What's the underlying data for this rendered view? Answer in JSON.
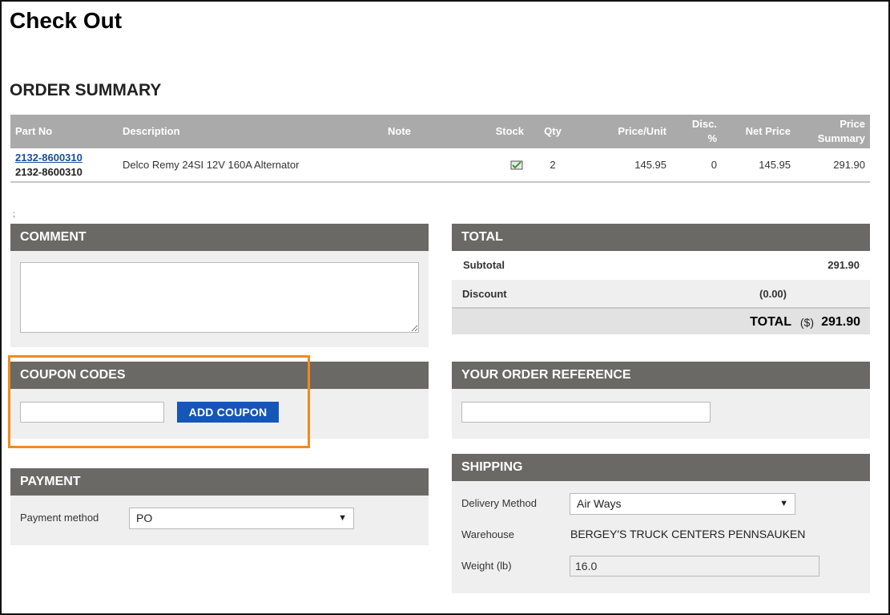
{
  "page": {
    "title": "Check Out",
    "section": "ORDER SUMMARY",
    "stray_mark": ";"
  },
  "table": {
    "headers": {
      "part_no": "Part No",
      "description": "Description",
      "note": "Note",
      "stock": "Stock",
      "qty": "Qty",
      "price_unit": "Price/Unit",
      "disc_line1": "Disc.",
      "disc_line2": "%",
      "net_price": "Net Price",
      "price_summary_line1": "Price",
      "price_summary_line2": "Summary"
    },
    "rows": [
      {
        "part_link": "2132-8600310",
        "part_sub": "2132-8600310",
        "description": "Delco Remy 24SI 12V 160A Alternator",
        "note": "",
        "stock_icon": "in-stock-check-icon",
        "qty": "2",
        "price_unit": "145.95",
        "disc": "0",
        "net_price": "145.95",
        "price_summary": "291.90"
      }
    ]
  },
  "comment": {
    "title": "COMMENT",
    "value": ""
  },
  "coupon": {
    "title": "COUPON CODES",
    "value": "",
    "button": "ADD COUPON",
    "highlight_color": "#f08a1c"
  },
  "payment": {
    "title": "PAYMENT",
    "method_label": "Payment method",
    "method_value": "PO"
  },
  "total": {
    "title": "TOTAL",
    "subtotal_label": "Subtotal",
    "subtotal_value": "291.90",
    "discount_label": "Discount",
    "discount_value": "(0.00)",
    "total_label": "TOTAL",
    "currency": "($)",
    "total_value": "291.90"
  },
  "order_reference": {
    "title": "YOUR ORDER REFERENCE",
    "value": ""
  },
  "shipping": {
    "title": "SHIPPING",
    "delivery_label": "Delivery Method",
    "delivery_value": "Air Ways",
    "warehouse_label": "Warehouse",
    "warehouse_value": "BERGEY'S TRUCK CENTERS PENNSAUKEN",
    "weight_label": "Weight (lb)",
    "weight_value": "16.0"
  },
  "colors": {
    "panel_header": "#6b6966",
    "table_header": "#aaaaaa",
    "button": "#1557b8",
    "link": "#1a4e9b"
  }
}
